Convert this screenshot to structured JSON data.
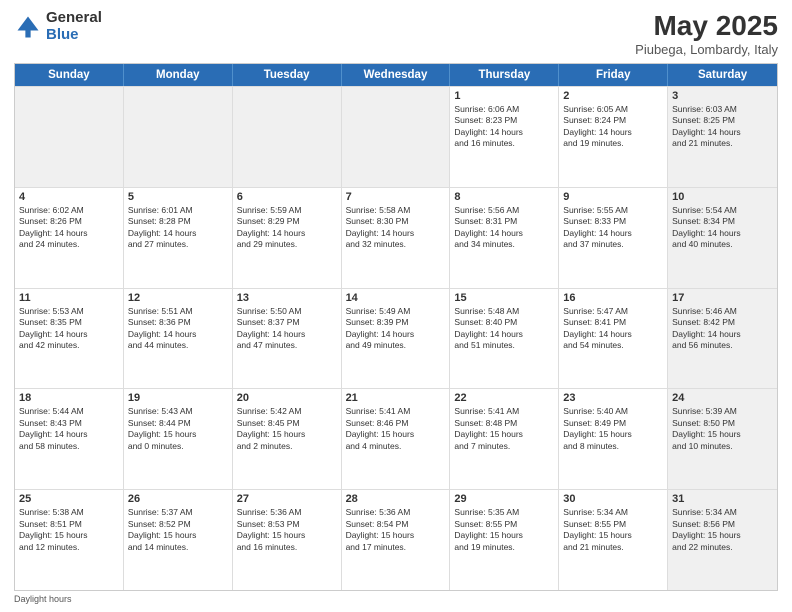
{
  "header": {
    "logo_general": "General",
    "logo_blue": "Blue",
    "title": "May 2025",
    "location": "Piubega, Lombardy, Italy"
  },
  "weekdays": [
    "Sunday",
    "Monday",
    "Tuesday",
    "Wednesday",
    "Thursday",
    "Friday",
    "Saturday"
  ],
  "rows": [
    [
      {
        "day": "",
        "text": "",
        "shaded": true
      },
      {
        "day": "",
        "text": "",
        "shaded": true
      },
      {
        "day": "",
        "text": "",
        "shaded": true
      },
      {
        "day": "",
        "text": "",
        "shaded": true
      },
      {
        "day": "1",
        "text": "Sunrise: 6:06 AM\nSunset: 8:23 PM\nDaylight: 14 hours\nand 16 minutes.",
        "shaded": false
      },
      {
        "day": "2",
        "text": "Sunrise: 6:05 AM\nSunset: 8:24 PM\nDaylight: 14 hours\nand 19 minutes.",
        "shaded": false
      },
      {
        "day": "3",
        "text": "Sunrise: 6:03 AM\nSunset: 8:25 PM\nDaylight: 14 hours\nand 21 minutes.",
        "shaded": true
      }
    ],
    [
      {
        "day": "4",
        "text": "Sunrise: 6:02 AM\nSunset: 8:26 PM\nDaylight: 14 hours\nand 24 minutes.",
        "shaded": false
      },
      {
        "day": "5",
        "text": "Sunrise: 6:01 AM\nSunset: 8:28 PM\nDaylight: 14 hours\nand 27 minutes.",
        "shaded": false
      },
      {
        "day": "6",
        "text": "Sunrise: 5:59 AM\nSunset: 8:29 PM\nDaylight: 14 hours\nand 29 minutes.",
        "shaded": false
      },
      {
        "day": "7",
        "text": "Sunrise: 5:58 AM\nSunset: 8:30 PM\nDaylight: 14 hours\nand 32 minutes.",
        "shaded": false
      },
      {
        "day": "8",
        "text": "Sunrise: 5:56 AM\nSunset: 8:31 PM\nDaylight: 14 hours\nand 34 minutes.",
        "shaded": false
      },
      {
        "day": "9",
        "text": "Sunrise: 5:55 AM\nSunset: 8:33 PM\nDaylight: 14 hours\nand 37 minutes.",
        "shaded": false
      },
      {
        "day": "10",
        "text": "Sunrise: 5:54 AM\nSunset: 8:34 PM\nDaylight: 14 hours\nand 40 minutes.",
        "shaded": true
      }
    ],
    [
      {
        "day": "11",
        "text": "Sunrise: 5:53 AM\nSunset: 8:35 PM\nDaylight: 14 hours\nand 42 minutes.",
        "shaded": false
      },
      {
        "day": "12",
        "text": "Sunrise: 5:51 AM\nSunset: 8:36 PM\nDaylight: 14 hours\nand 44 minutes.",
        "shaded": false
      },
      {
        "day": "13",
        "text": "Sunrise: 5:50 AM\nSunset: 8:37 PM\nDaylight: 14 hours\nand 47 minutes.",
        "shaded": false
      },
      {
        "day": "14",
        "text": "Sunrise: 5:49 AM\nSunset: 8:39 PM\nDaylight: 14 hours\nand 49 minutes.",
        "shaded": false
      },
      {
        "day": "15",
        "text": "Sunrise: 5:48 AM\nSunset: 8:40 PM\nDaylight: 14 hours\nand 51 minutes.",
        "shaded": false
      },
      {
        "day": "16",
        "text": "Sunrise: 5:47 AM\nSunset: 8:41 PM\nDaylight: 14 hours\nand 54 minutes.",
        "shaded": false
      },
      {
        "day": "17",
        "text": "Sunrise: 5:46 AM\nSunset: 8:42 PM\nDaylight: 14 hours\nand 56 minutes.",
        "shaded": true
      }
    ],
    [
      {
        "day": "18",
        "text": "Sunrise: 5:44 AM\nSunset: 8:43 PM\nDaylight: 14 hours\nand 58 minutes.",
        "shaded": false
      },
      {
        "day": "19",
        "text": "Sunrise: 5:43 AM\nSunset: 8:44 PM\nDaylight: 15 hours\nand 0 minutes.",
        "shaded": false
      },
      {
        "day": "20",
        "text": "Sunrise: 5:42 AM\nSunset: 8:45 PM\nDaylight: 15 hours\nand 2 minutes.",
        "shaded": false
      },
      {
        "day": "21",
        "text": "Sunrise: 5:41 AM\nSunset: 8:46 PM\nDaylight: 15 hours\nand 4 minutes.",
        "shaded": false
      },
      {
        "day": "22",
        "text": "Sunrise: 5:41 AM\nSunset: 8:48 PM\nDaylight: 15 hours\nand 7 minutes.",
        "shaded": false
      },
      {
        "day": "23",
        "text": "Sunrise: 5:40 AM\nSunset: 8:49 PM\nDaylight: 15 hours\nand 8 minutes.",
        "shaded": false
      },
      {
        "day": "24",
        "text": "Sunrise: 5:39 AM\nSunset: 8:50 PM\nDaylight: 15 hours\nand 10 minutes.",
        "shaded": true
      }
    ],
    [
      {
        "day": "25",
        "text": "Sunrise: 5:38 AM\nSunset: 8:51 PM\nDaylight: 15 hours\nand 12 minutes.",
        "shaded": false
      },
      {
        "day": "26",
        "text": "Sunrise: 5:37 AM\nSunset: 8:52 PM\nDaylight: 15 hours\nand 14 minutes.",
        "shaded": false
      },
      {
        "day": "27",
        "text": "Sunrise: 5:36 AM\nSunset: 8:53 PM\nDaylight: 15 hours\nand 16 minutes.",
        "shaded": false
      },
      {
        "day": "28",
        "text": "Sunrise: 5:36 AM\nSunset: 8:54 PM\nDaylight: 15 hours\nand 17 minutes.",
        "shaded": false
      },
      {
        "day": "29",
        "text": "Sunrise: 5:35 AM\nSunset: 8:55 PM\nDaylight: 15 hours\nand 19 minutes.",
        "shaded": false
      },
      {
        "day": "30",
        "text": "Sunrise: 5:34 AM\nSunset: 8:55 PM\nDaylight: 15 hours\nand 21 minutes.",
        "shaded": false
      },
      {
        "day": "31",
        "text": "Sunrise: 5:34 AM\nSunset: 8:56 PM\nDaylight: 15 hours\nand 22 minutes.",
        "shaded": true
      }
    ]
  ],
  "footer": {
    "note": "Daylight hours"
  }
}
